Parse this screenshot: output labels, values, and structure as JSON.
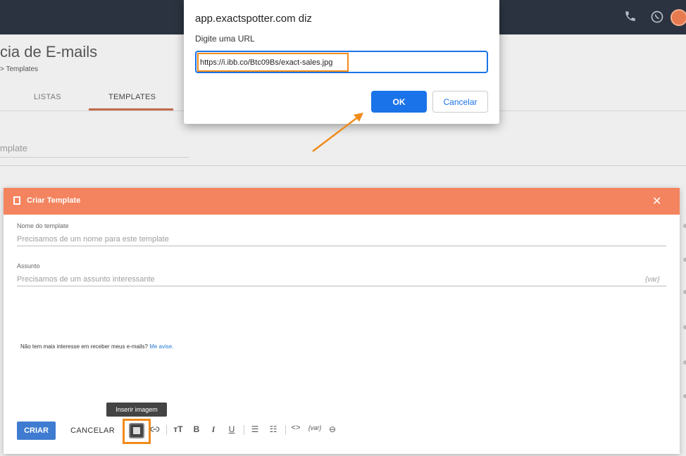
{
  "topbar": {
    "icons": [
      "phone-icon",
      "whatsapp-icon"
    ],
    "avatar_color": "#e77a4f"
  },
  "background_page": {
    "title": "cia de E-mails",
    "breadcrumb": "Templates",
    "tabs": [
      {
        "label": "LISTAS"
      },
      {
        "label": "TEMPLATES"
      }
    ],
    "search_placeholder": "mplate"
  },
  "modal": {
    "title": "Criar Template",
    "accent_color": "#f4845f",
    "name_field": {
      "label": "Nome do template",
      "placeholder": "Precisamos de um nome para este template"
    },
    "subject_field": {
      "label": "Assunto",
      "placeholder": "Precisamos de um assunto interessante",
      "var_tag": "{var}"
    },
    "unsubscribe": {
      "text": "Não tem mais interesse em receber meus e-mails?",
      "link": "Me avise."
    },
    "create_label": "CRIAR",
    "cancel_label": "CANCELAR",
    "tooltip": "Inserir imagem",
    "toolbar": {
      "var_label": "{var}"
    }
  },
  "prompt": {
    "title": "app.exactspotter.com diz",
    "message": "Digite uma URL",
    "value": "https://i.ibb.co/Btc09Bs/exact-sales.jpg",
    "ok_label": "OK",
    "cancel_label": "Cancelar",
    "ok_color": "#1a73e8"
  },
  "highlight_color": "#f08b1a"
}
